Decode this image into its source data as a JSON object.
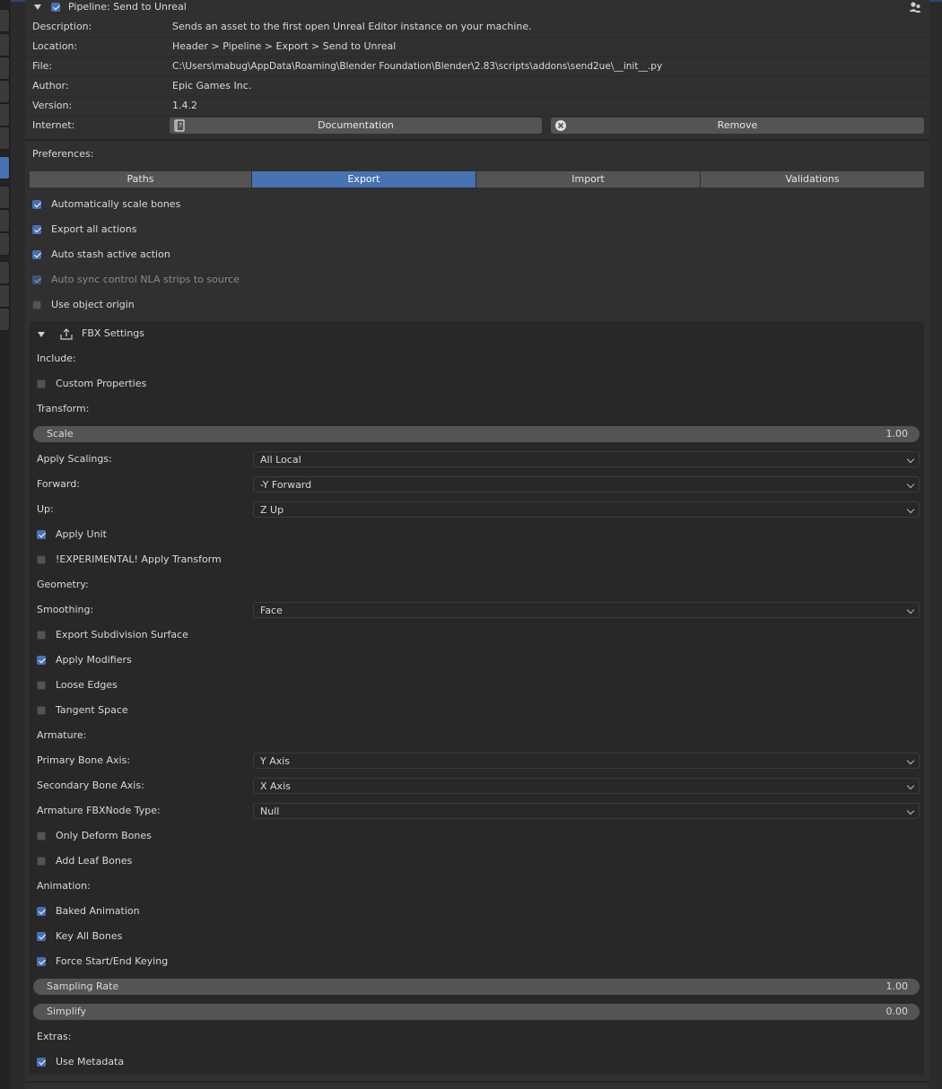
{
  "addon": {
    "title": "Pipeline: Send to Unreal",
    "description_label": "Description:",
    "description": "Sends an asset to the first open Unreal Editor instance on your machine.",
    "location_label": "Location:",
    "location": "Header > Pipeline > Export > Send to Unreal",
    "file_label": "File:",
    "file": "C:\\Users\\mabug\\AppData\\Roaming\\Blender Foundation\\Blender\\2.83\\scripts\\addons\\send2ue\\__init__.py",
    "author_label": "Author:",
    "author": "Epic Games Inc.",
    "version_label": "Version:",
    "version": "1.4.2",
    "internet_label": "Internet:",
    "documentation_button": "Documentation",
    "remove_button": "Remove",
    "user_icon": "user-icon",
    "book_icon": "book-icon",
    "remove_icon": "close-circle-icon"
  },
  "preferences": {
    "label": "Preferences:",
    "tabs": [
      "Paths",
      "Export",
      "Import",
      "Validations"
    ],
    "active_tab": "Export",
    "options": [
      {
        "label": "Automatically scale bones",
        "checked": true
      },
      {
        "label": "Export all actions",
        "checked": true
      },
      {
        "label": "Auto stash active action",
        "checked": true
      },
      {
        "label": "Auto sync control NLA strips to source",
        "checked": true,
        "disabled": true
      },
      {
        "label": "Use object origin",
        "checked": false
      }
    ]
  },
  "fbx": {
    "title": "FBX Settings",
    "icon": "export-icon",
    "include_label": "Include:",
    "custom_properties": "Custom Properties",
    "transform_label": "Transform:",
    "scale_label": "Scale",
    "scale_value": "1.00",
    "apply_scalings_label": "Apply Scalings:",
    "apply_scalings": "All Local",
    "forward_label": "Forward:",
    "forward": "-Y Forward",
    "up_label": "Up:",
    "up": "Z Up",
    "apply_unit": "Apply Unit",
    "apply_transform": "!EXPERIMENTAL! Apply Transform",
    "geometry_label": "Geometry:",
    "smoothing_label": "Smoothing:",
    "smoothing": "Face",
    "export_subdivision": "Export Subdivision Surface",
    "apply_modifiers": "Apply Modifiers",
    "loose_edges": "Loose Edges",
    "tangent_space": "Tangent Space",
    "armature_label": "Armature:",
    "primary_bone_label": "Primary Bone Axis:",
    "primary_bone": "Y Axis",
    "secondary_bone_label": "Secondary Bone Axis:",
    "secondary_bone": "X Axis",
    "armature_node_label": "Armature FBXNode Type:",
    "armature_node": "Null",
    "only_deform": "Only Deform Bones",
    "add_leaf": "Add Leaf Bones",
    "animation_label": "Animation:",
    "baked_animation": "Baked Animation",
    "key_all_bones": "Key All Bones",
    "force_keying": "Force Start/End Keying",
    "sampling_rate_label": "Sampling Rate",
    "sampling_rate": "1.00",
    "simplify_label": "Simplify",
    "simplify": "0.00",
    "extras_label": "Extras:",
    "use_metadata": "Use Metadata"
  },
  "colors": {
    "accent": "#4772b3",
    "panel": "#303030",
    "subpanel": "#282828",
    "widget": "#545454"
  }
}
